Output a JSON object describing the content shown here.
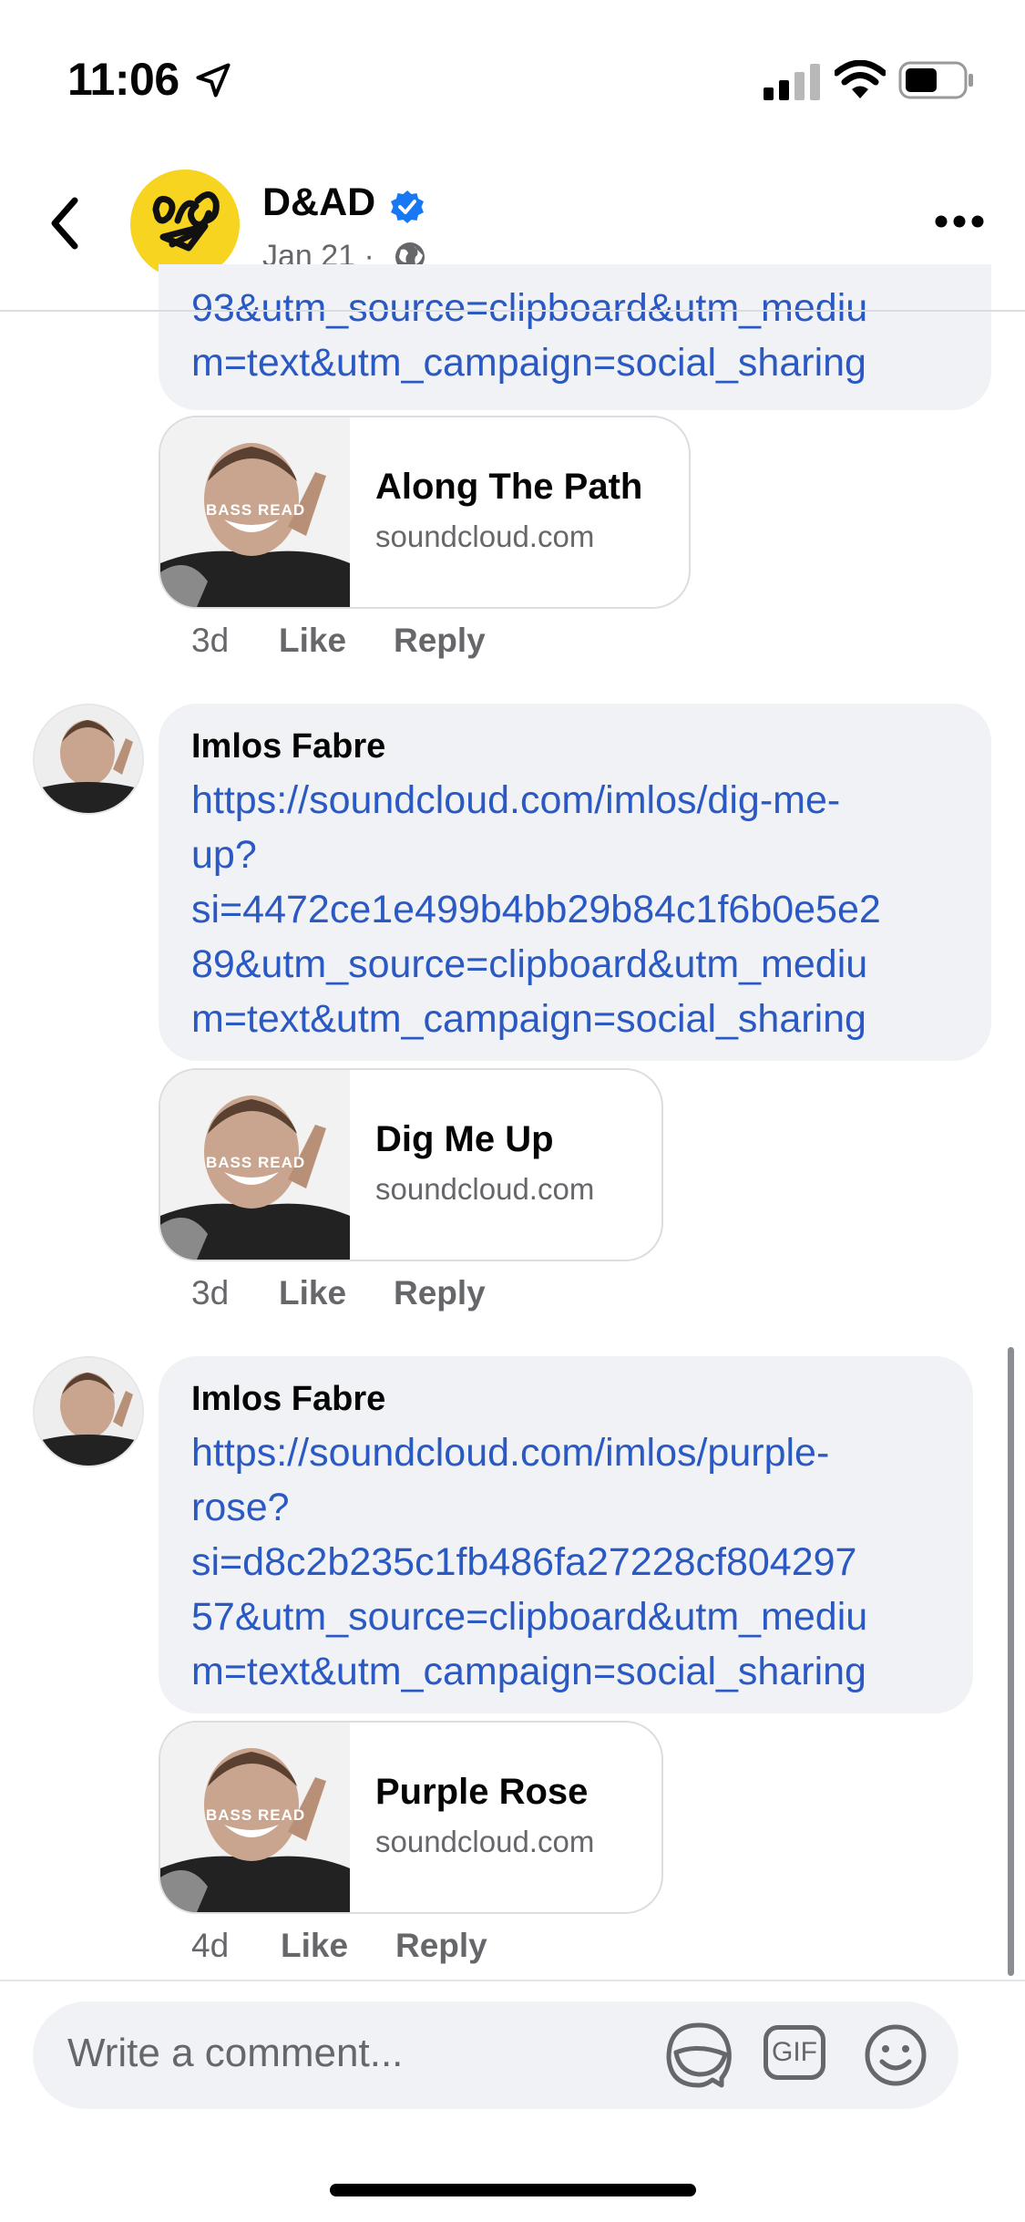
{
  "status_bar": {
    "time": "11:06"
  },
  "header": {
    "page_name": "D&AD",
    "date": "Jan 21 ·"
  },
  "comments": [
    {
      "link_lines": [
        "93&utm_source=clipboard&utm_mediu",
        "m=text&utm_campaign=social_sharing"
      ],
      "card": {
        "title": "Along The Path",
        "domain": "soundcloud.com"
      },
      "meta": {
        "age": "3d",
        "like": "Like",
        "reply": "Reply"
      }
    },
    {
      "author": "Imlos Fabre",
      "link_lines": [
        "https://soundcloud.com/imlos/dig-me-",
        "up?",
        "si=4472ce1e499b4bb29b84c1f6b0e5e2",
        "89&utm_source=clipboard&utm_mediu",
        "m=text&utm_campaign=social_sharing"
      ],
      "card": {
        "title": "Dig Me Up",
        "domain": "soundcloud.com"
      },
      "meta": {
        "age": "3d",
        "like": "Like",
        "reply": "Reply"
      }
    },
    {
      "author": "Imlos Fabre",
      "link_lines": [
        "https://soundcloud.com/imlos/purple-",
        "rose?",
        "si=d8c2b235c1fb486fa27228cf804297",
        "57&utm_source=clipboard&utm_mediu",
        "m=text&utm_campaign=social_sharing"
      ],
      "card": {
        "title": "Purple Rose",
        "domain": "soundcloud.com"
      },
      "meta": {
        "age": "4d",
        "like": "Like",
        "reply": "Reply"
      }
    }
  ],
  "thumb_overlay_text": "BASS READ",
  "composer": {
    "placeholder": "Write a comment...",
    "gif_label": "GIF"
  },
  "icons": [
    "location-arrow-icon",
    "signal-icon",
    "wifi-icon",
    "battery-icon",
    "back-chevron-icon",
    "verified-badge-icon",
    "globe-icon",
    "more-icon",
    "sticker-icon",
    "gif-icon",
    "emoji-icon"
  ],
  "colors": {
    "link": "#2b59c3",
    "bubble": "#f0f2f5",
    "verified": "#1877f2",
    "brand_yellow": "#f7d420",
    "secondary_text": "#65676b"
  }
}
